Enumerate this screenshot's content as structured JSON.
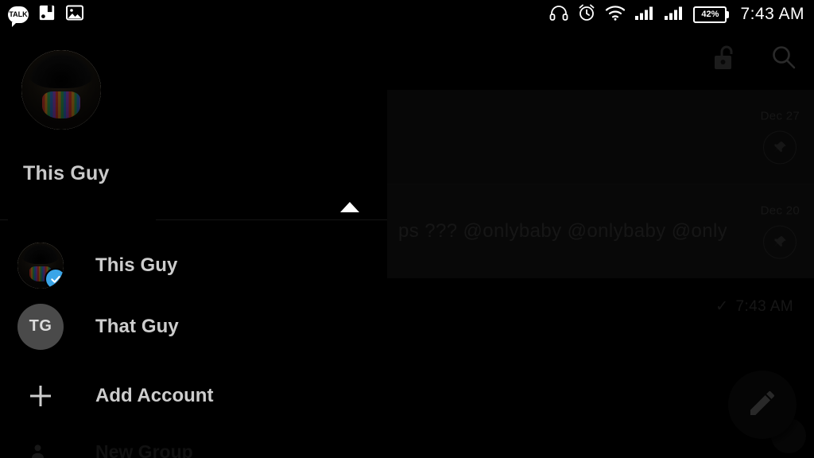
{
  "status_bar": {
    "time": "7:43 AM",
    "battery_percent": "42%",
    "left_icons": [
      "talk-bubble-icon",
      "save-icon",
      "image-icon"
    ],
    "right_icons": [
      "headphones-icon",
      "alarm-clock-icon",
      "wifi-icon",
      "signal-sim1-icon",
      "signal-sim2-icon",
      "battery-icon"
    ],
    "talk_label": "TALK"
  },
  "top_bar": {
    "lock_icon": "unlocked-padlock-icon",
    "search_icon": "search-icon"
  },
  "chat_list": {
    "rows": [
      {
        "date": "Dec 27",
        "preview": "",
        "pinned": true
      },
      {
        "date": "Dec 20",
        "preview": "ps ???   @onlybaby @onlybaby @onlybaby",
        "pinned": true
      }
    ],
    "sent_status": {
      "check": "✓",
      "time": "7:43 AM"
    }
  },
  "fab": {
    "icon": "pencil-compose-icon"
  },
  "drawer": {
    "profile": {
      "name": "This Guy",
      "avatar": "profile-photo",
      "subtitle_redacted": true,
      "caret": "collapse-caret-up-icon"
    },
    "accounts": [
      {
        "label": "This Guy",
        "avatar_type": "photo",
        "initials": "",
        "selected": true
      },
      {
        "label": "That Guy",
        "avatar_type": "initials",
        "initials": "TG",
        "selected": false
      }
    ],
    "add_account": {
      "label": "Add Account",
      "icon": "plus-icon"
    },
    "partial_item": {
      "label": "New Group",
      "icon": "new-group-icon"
    }
  },
  "colors": {
    "accent_blue": "#3aa5e8",
    "background": "#000000",
    "panel": "#141414",
    "text_primary": "#cdcdcd",
    "text_dim": "#3a3a3a"
  }
}
